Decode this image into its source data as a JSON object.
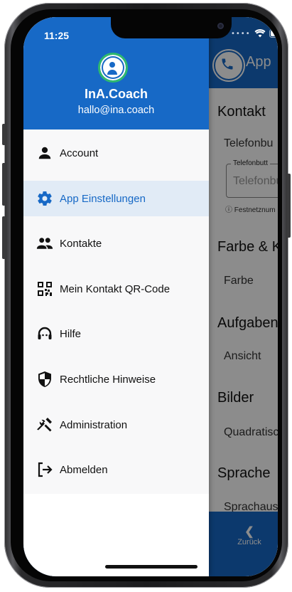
{
  "status_bar": {
    "time": "11:25"
  },
  "drawer": {
    "app_name": "InA.Coach",
    "email": "hallo@ina.coach",
    "items": [
      {
        "label": "Account",
        "icon": "person-icon",
        "active": false
      },
      {
        "label": "App Einstellungen",
        "icon": "gear-icon",
        "active": true
      },
      {
        "label": "Kontakte",
        "icon": "people-icon",
        "active": false
      },
      {
        "label": "Mein Kontakt QR-Code",
        "icon": "qr-code-icon",
        "active": false
      },
      {
        "label": "Hilfe",
        "icon": "help-person-icon",
        "active": false
      },
      {
        "label": "Rechtliche Hinweise",
        "icon": "shield-icon",
        "active": false
      },
      {
        "label": "Administration",
        "icon": "tools-icon",
        "active": false
      },
      {
        "label": "Abmelden",
        "icon": "logout-icon",
        "active": false
      }
    ]
  },
  "background_page": {
    "title": "App",
    "sections": {
      "kontakt": "Kontakt",
      "telefonbutton": "Telefonbu",
      "field_label": "Telefonbutt",
      "field_placeholder": "Telefonbu",
      "hint": "ⓘ Festnetznum",
      "farbe_section": "Farbe & Ko",
      "farbe": "Farbe",
      "aufgaben": "Aufgabenl",
      "ansicht": "Ansicht",
      "bilder": "Bilder",
      "quadratisch": "Quadratisc",
      "sprache": "Sprache",
      "sprachauswahl": "Sprachaus"
    },
    "back_label": "Zurück"
  },
  "colors": {
    "primary": "#1769c6",
    "active_bg": "#e1ebf6",
    "avatar_ring": "#2fb96f"
  }
}
